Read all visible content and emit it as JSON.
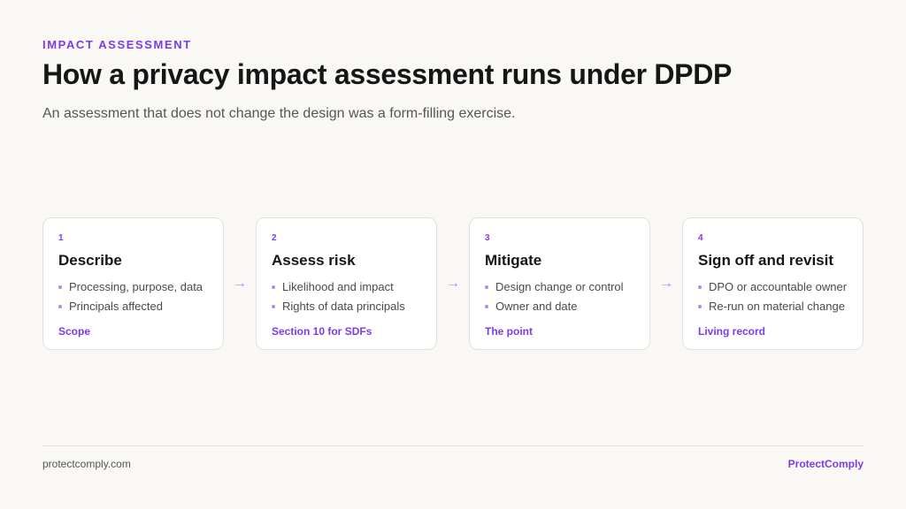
{
  "header": {
    "eyebrow": "IMPACT ASSESSMENT",
    "title": "How a privacy impact assessment runs under DPDP",
    "subtitle": "An assessment that does not change the design was a form-filling exercise."
  },
  "steps": [
    {
      "number": "1",
      "title": "Describe",
      "bullets": [
        "Processing, purpose, data",
        "Principals affected"
      ],
      "tag": "Scope"
    },
    {
      "number": "2",
      "title": "Assess risk",
      "bullets": [
        "Likelihood and impact",
        "Rights of data principals"
      ],
      "tag": "Section 10 for SDFs"
    },
    {
      "number": "3",
      "title": "Mitigate",
      "bullets": [
        "Design change or control",
        "Owner and date"
      ],
      "tag": "The point"
    },
    {
      "number": "4",
      "title": "Sign off and revisit",
      "bullets": [
        "DPO or accountable owner",
        "Re-run on material change"
      ],
      "tag": "Living record"
    }
  ],
  "arrow_glyph": "→",
  "footer": {
    "site": "protectcomply.com",
    "brand": "ProtectComply"
  },
  "colors": {
    "accent": "#7c3aed",
    "background": "#f9f8f5"
  }
}
